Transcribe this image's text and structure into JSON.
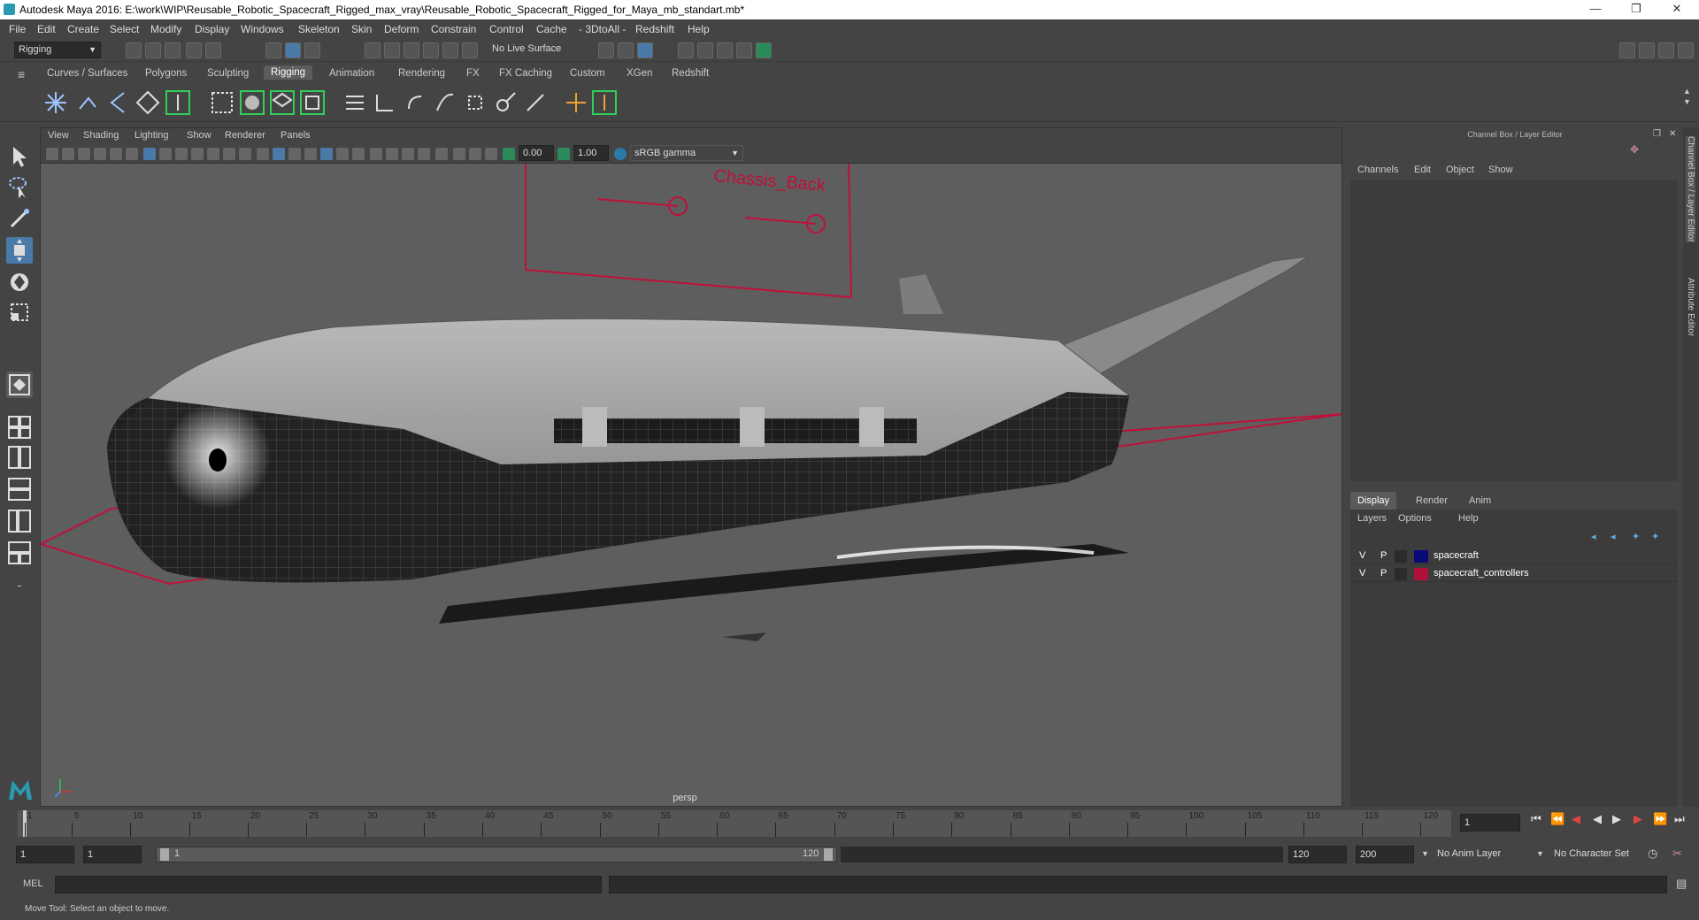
{
  "window": {
    "title": "Autodesk Maya 2016: E:\\work\\WIP\\Reusable_Robotic_Spacecraft_Rigged_max_vray\\Reusable_Robotic_Spacecraft_Rigged_for_Maya_mb_standart.mb*",
    "minimize": "—",
    "restore": "❐",
    "close": "✕"
  },
  "menubar": [
    "File",
    "Edit",
    "Create",
    "Select",
    "Modify",
    "Display",
    "Windows",
    "Skeleton",
    "Skin",
    "Deform",
    "Constrain",
    "Control",
    "Cache",
    "- 3DtoAll -",
    "Redshift",
    "Help"
  ],
  "statusline": {
    "mode": "Rigging",
    "live_surface": "No Live Surface"
  },
  "shelf": {
    "tabs": [
      "Curves / Surfaces",
      "Polygons",
      "Sculpting",
      "Rigging",
      "Animation",
      "Rendering",
      "FX",
      "FX Caching",
      "Custom",
      "XGen",
      "Redshift"
    ],
    "active": "Rigging"
  },
  "viewport": {
    "menus": [
      "View",
      "Shading",
      "Lighting",
      "Show",
      "Renderer",
      "Panels"
    ],
    "exposure": "0.00",
    "gamma": "1.00",
    "colorspace": "sRGB gamma",
    "camera": "persp",
    "controller_label": "Chassis_Back"
  },
  "channelbox": {
    "title": "Channel Box / Layer Editor",
    "menus": [
      "Channels",
      "Edit",
      "Object",
      "Show"
    ],
    "layer_tabs": [
      "Display",
      "Render",
      "Anim"
    ],
    "active_tab": "Display",
    "layer_menus": [
      "Layers",
      "Options",
      "Help"
    ],
    "layers": [
      {
        "v": "V",
        "p": "P",
        "name": "spacecraft",
        "color": "#0a0a7a"
      },
      {
        "v": "V",
        "p": "P",
        "name": "spacecraft_controllers",
        "color": "#b0103a"
      }
    ],
    "side_tabs": [
      "Channel Box / Layer Editor",
      "Attribute Editor"
    ]
  },
  "timeline": {
    "ticks": [
      "1",
      "5",
      "10",
      "15",
      "20",
      "25",
      "30",
      "35",
      "40",
      "45",
      "50",
      "55",
      "60",
      "65",
      "70",
      "75",
      "80",
      "85",
      "90",
      "95",
      "100",
      "105",
      "110",
      "115",
      "120"
    ],
    "current_frame": "1"
  },
  "range": {
    "start": "1",
    "start2": "1",
    "slider_start": "1",
    "slider_end": "120",
    "end": "120",
    "end2": "200",
    "anim_layer": "No Anim Layer",
    "char_set": "No Character Set"
  },
  "mel": {
    "label": "MEL"
  },
  "help": "Move Tool: Select an object to move."
}
